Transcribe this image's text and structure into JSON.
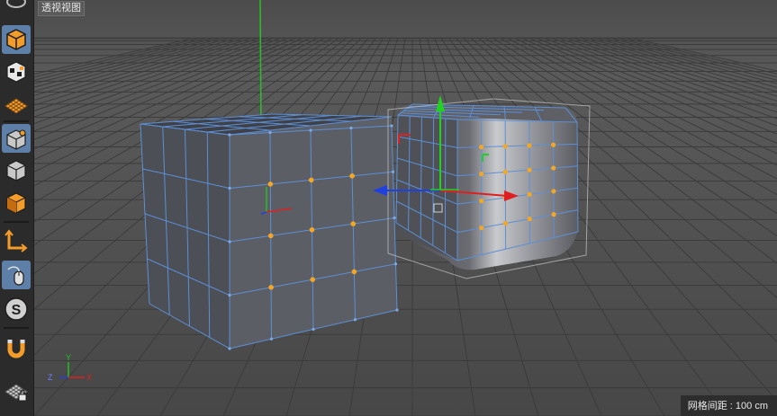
{
  "viewport": {
    "label": "透视视图",
    "grid_label": "网格间距",
    "grid_separator": " : ",
    "grid_value": "100 cm"
  },
  "toolbar": {
    "tools": [
      {
        "icon": "view-cube-icon",
        "active": false
      },
      {
        "icon": "model-mode-icon",
        "active": true
      },
      {
        "icon": "texture-mode-icon",
        "active": false
      },
      {
        "icon": "workplane-mode-icon",
        "active": false
      },
      {
        "icon": "points-mode-icon",
        "active": true
      },
      {
        "icon": "edges-mode-icon",
        "active": false
      },
      {
        "icon": "polygons-mode-icon",
        "active": false
      },
      {
        "icon": "axis-mode-icon",
        "active": false
      },
      {
        "icon": "tweak-mode-icon",
        "active": true
      },
      {
        "icon": "snapping-icon",
        "active": false
      },
      {
        "icon": "magnet-icon",
        "active": false
      },
      {
        "icon": "lock-workplane-icon",
        "active": false
      }
    ]
  },
  "axis_gizmo": {
    "labels": [
      "Y",
      "Z",
      "X"
    ]
  },
  "colors": {
    "selection_edge": "#5d8fd6",
    "selected_point": "#f5a623",
    "axis_x": "#e02020",
    "axis_y": "#20c020",
    "axis_z": "#2040e0",
    "active_tool": "#5d7fa8"
  }
}
